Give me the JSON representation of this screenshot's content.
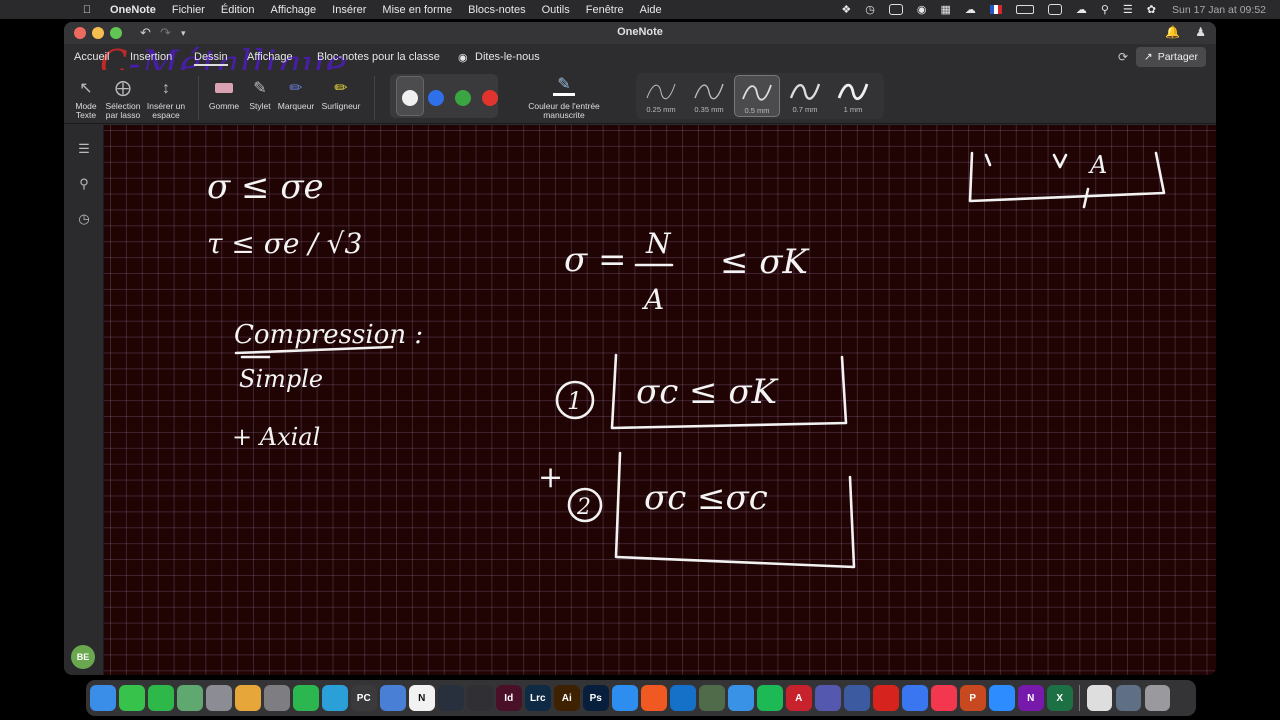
{
  "menubar": {
    "app_name": "OneNote",
    "items": [
      "Fichier",
      "Édition",
      "Affichage",
      "Insérer",
      "Mise en forme",
      "Blocs-notes",
      "Outils",
      "Fenêtre",
      "Aide"
    ],
    "clock": "Sun 17 Jan at  09:52"
  },
  "window": {
    "title": "OneNote"
  },
  "ribbon": {
    "tabs": [
      "Accueil",
      "Insertion",
      "Dessin",
      "Affichage",
      "Bloc-notes pour la classe"
    ],
    "active_tab": "Dessin",
    "tell_me": "Dites-le-nous",
    "share_label": "Partager",
    "watermark_text": "C-Métallique"
  },
  "toolbar": {
    "tools": [
      {
        "line1": "Mode",
        "line2": "Texte"
      },
      {
        "line1": "Sélection",
        "line2": "par lasso"
      },
      {
        "line1": "Insérer un",
        "line2": "espace"
      },
      {
        "line1": "Gomme",
        "line2": ""
      },
      {
        "line1": "Stylet",
        "line2": ""
      },
      {
        "line1": "Marqueur",
        "line2": ""
      },
      {
        "line1": "Surligneur",
        "line2": ""
      }
    ],
    "pen_colors": [
      "#f0f0f0",
      "#2f6fe8",
      "#3aa541",
      "#e2342f"
    ],
    "ink_color_label": {
      "line1": "Couleur de l'entrée",
      "line2": "manuscrite"
    },
    "thicknesses": [
      "0.25 mm",
      "0.35 mm",
      "0.5 mm",
      "0.7 mm",
      "1 mm"
    ],
    "selected_thickness": "0.5 mm"
  },
  "sidebar": {
    "avatar_initials": "BE"
  },
  "notes": {
    "left_col": {
      "line1": "σ ≤ σe",
      "line2": "τ ≤ σe / √3",
      "heading": "Compression :",
      "sub1": "Simple",
      "sub2": "+ Axial"
    },
    "right_col": {
      "formula_lhs": "σ =",
      "formula_num": "N",
      "formula_den": "A",
      "formula_rhs": "≤  σK",
      "box1_index": "1",
      "box1_text": "σc  ≤  σK",
      "plus": "+",
      "box2_index": "2",
      "box2_text": "σc  ≤σc",
      "top_right_fragment": "A"
    }
  },
  "dock": {
    "icons": [
      {
        "name": "finder-icon",
        "color": "#3b8ee8",
        "label": ""
      },
      {
        "name": "messages-icon",
        "color": "#37c24b",
        "label": ""
      },
      {
        "name": "facetime-icon",
        "color": "#2fb84a",
        "label": ""
      },
      {
        "name": "maps-icon",
        "color": "#5fa86f",
        "label": ""
      },
      {
        "name": "launchpad-icon",
        "color": "#8c8c94",
        "label": ""
      },
      {
        "name": "photos-icon",
        "color": "#e7a63a",
        "label": ""
      },
      {
        "name": "settings-icon",
        "color": "#7d7d82",
        "label": ""
      },
      {
        "name": "whatsapp-icon",
        "color": "#2bb64f",
        "label": ""
      },
      {
        "name": "telegram-icon",
        "color": "#2a9fd8",
        "label": ""
      },
      {
        "name": "pc-icon",
        "color": "#3a3a3c",
        "label": "PC"
      },
      {
        "name": "pen-app-icon",
        "color": "#4a7fd6",
        "label": ""
      },
      {
        "name": "notion-icon",
        "color": "#f2f2f2",
        "label": "N"
      },
      {
        "name": "davinci-icon",
        "color": "#27303c",
        "label": ""
      },
      {
        "name": "obs-icon",
        "color": "#303034",
        "label": ""
      },
      {
        "name": "indesign-icon",
        "color": "#4a1027",
        "label": "Id"
      },
      {
        "name": "lightroom-icon",
        "color": "#0f2a44",
        "label": "Lrc"
      },
      {
        "name": "illustrator-icon",
        "color": "#3d2100",
        "label": "Ai"
      },
      {
        "name": "photoshop-icon",
        "color": "#071f3c",
        "label": "Ps"
      },
      {
        "name": "appstore-icon",
        "color": "#2d8ef0",
        "label": ""
      },
      {
        "name": "brave-icon",
        "color": "#f05a22",
        "label": ""
      },
      {
        "name": "outlook-icon",
        "color": "#1571c8",
        "label": ""
      },
      {
        "name": "vpn-icon",
        "color": "#4f6b4a",
        "label": ""
      },
      {
        "name": "safari-icon",
        "color": "#3a92e6",
        "label": ""
      },
      {
        "name": "spotify-icon",
        "color": "#1cb954",
        "label": ""
      },
      {
        "name": "autocad-icon",
        "color": "#c8232c",
        "label": "A"
      },
      {
        "name": "teams-icon",
        "color": "#5558af",
        "label": ""
      },
      {
        "name": "shield-app-icon",
        "color": "#3c5aa0",
        "label": ""
      },
      {
        "name": "acrobat-icon",
        "color": "#d6231e",
        "label": ""
      },
      {
        "name": "signal-icon",
        "color": "#3a76f0",
        "label": ""
      },
      {
        "name": "music-icon",
        "color": "#f2374f",
        "label": ""
      },
      {
        "name": "powerpoint-icon",
        "color": "#c8491f",
        "label": "P"
      },
      {
        "name": "zoom-icon",
        "color": "#2d8cff",
        "label": ""
      },
      {
        "name": "onenote-icon",
        "color": "#7719aa",
        "label": "N"
      },
      {
        "name": "excel-icon",
        "color": "#1d7044",
        "label": "X"
      },
      {
        "name": "document-icon",
        "color": "#dedede",
        "label": ""
      },
      {
        "name": "downloads-icon",
        "color": "#5e6f86",
        "label": ""
      },
      {
        "name": "trash-icon",
        "color": "#9a9a9e",
        "label": ""
      }
    ]
  }
}
